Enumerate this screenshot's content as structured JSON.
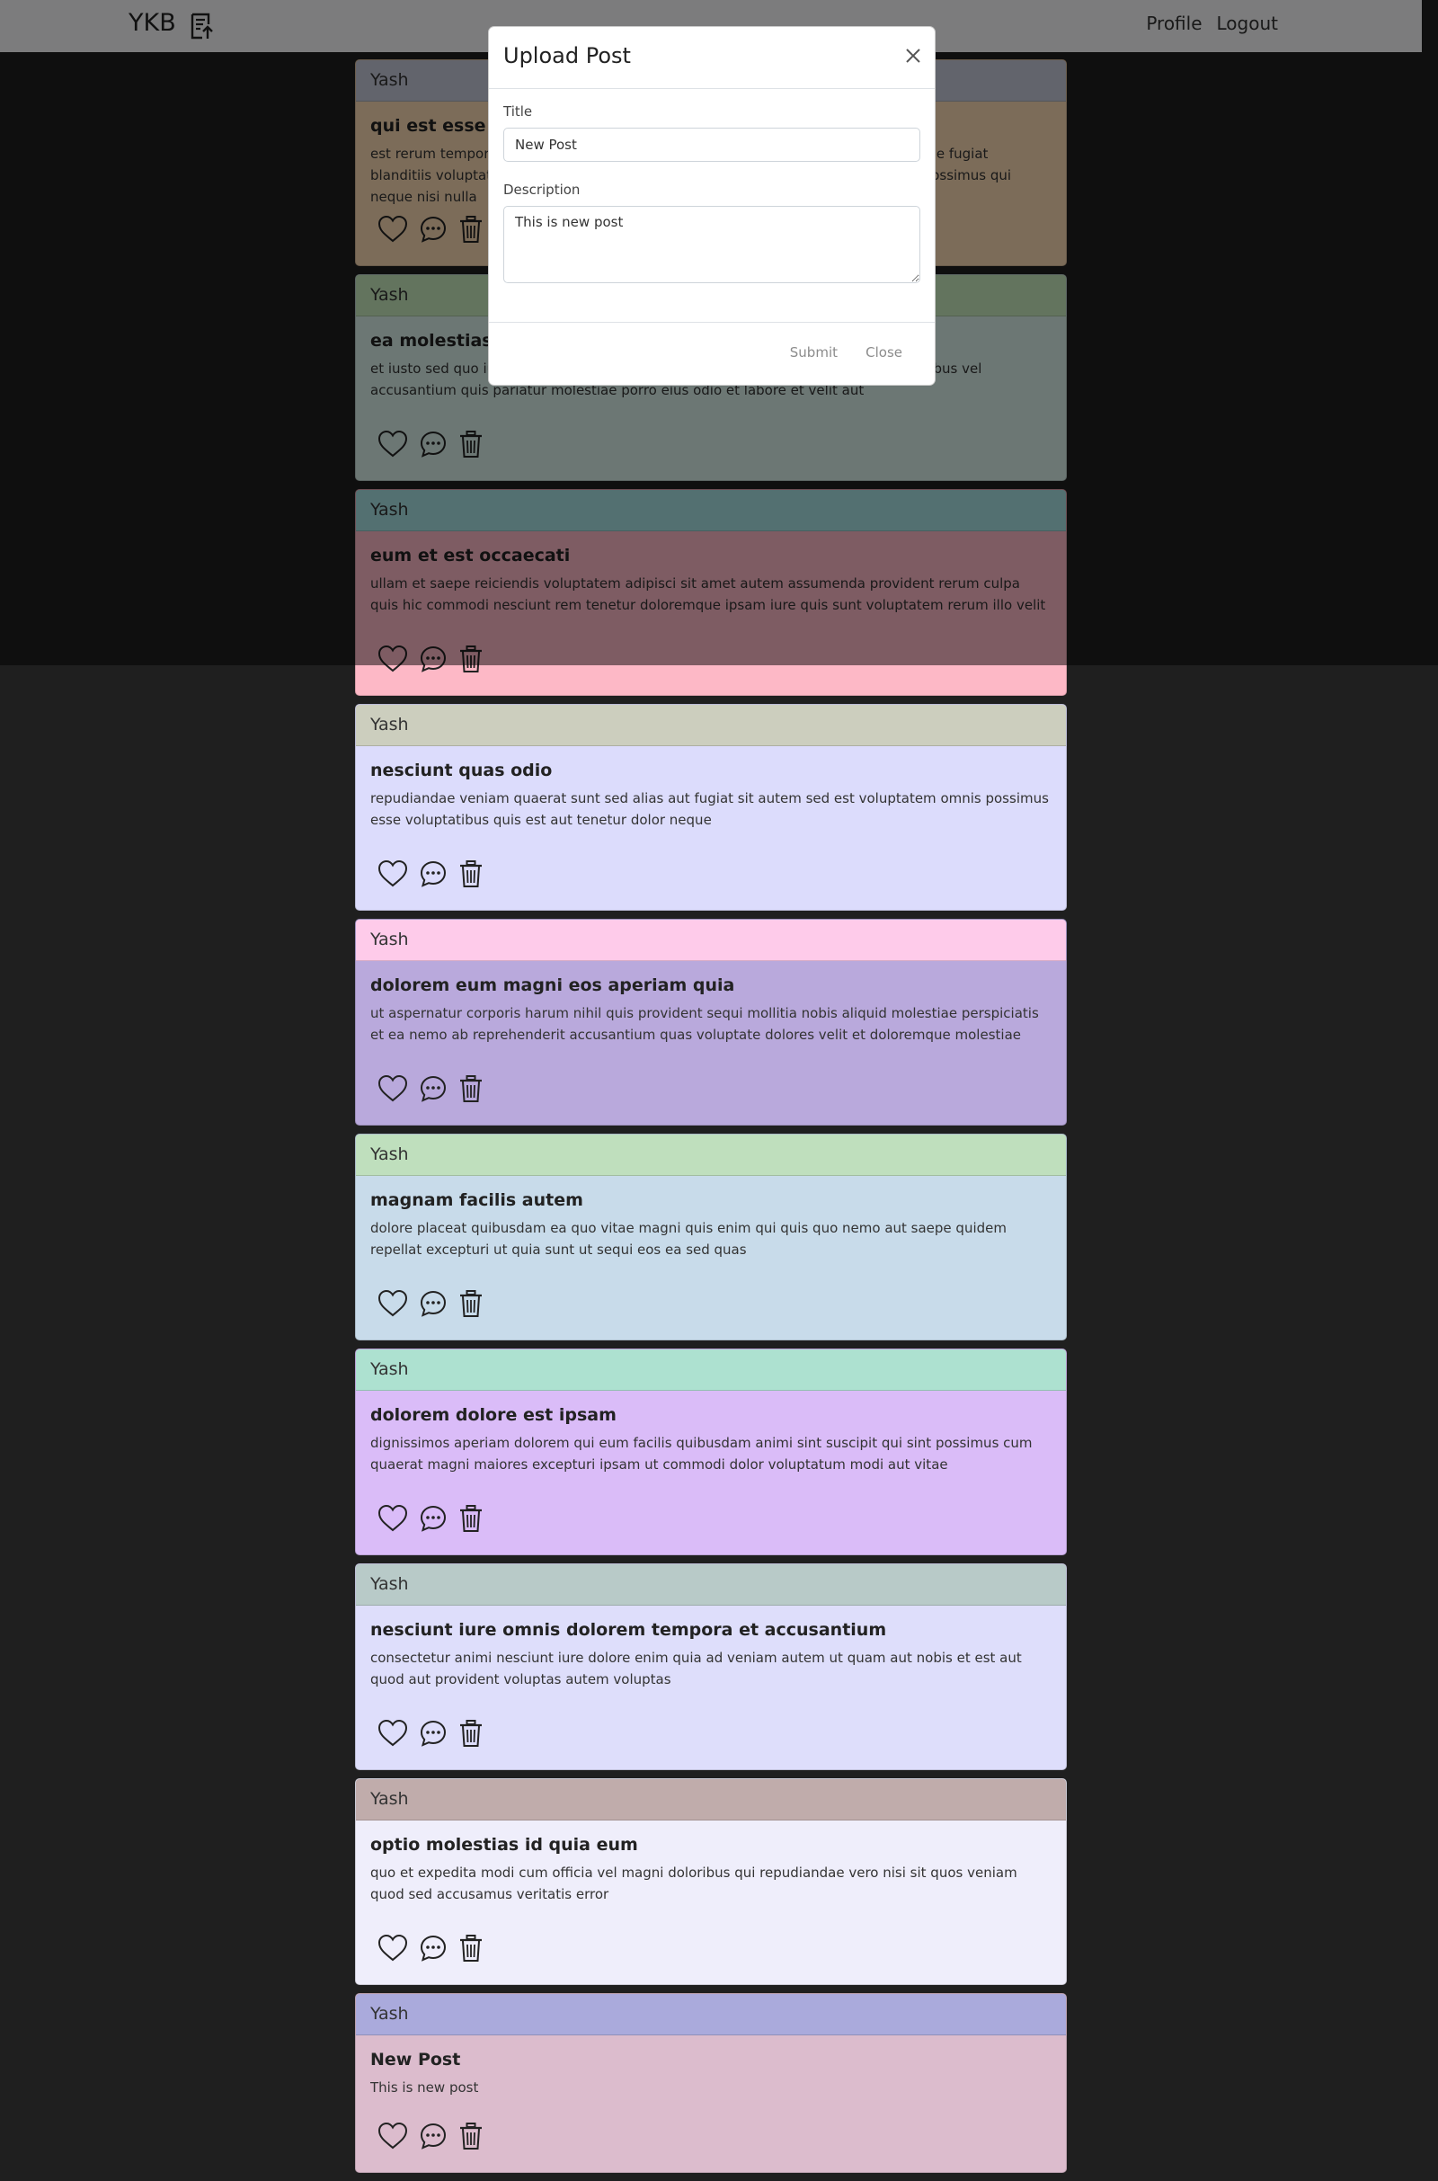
{
  "navbar": {
    "brand": "YKB",
    "upload_icon": "upload-post-icon",
    "links": [
      "Profile",
      "Logout"
    ]
  },
  "posts": [
    {
      "author": "Yash",
      "title": "qui est esse",
      "body": "est rerum tempore vitae sequi sint nihil reprehenderit dolor beatae ea dolores neque fugiat blanditiis voluptate porro vel nihil molestiae ut reiciendis qui aperiam non debitis possimus qui neque nisi nulla",
      "header_color": "#c5c8d8",
      "body_color": "#f9d9b3"
    },
    {
      "author": "Yash",
      "title": "ea molestias quasi exercitationem repellat qui ipsa sit aut",
      "body": "et iusto sed quo iure voluptatem occaecati omnis eligendi aut ad voluptatem doloribus vel accusantium quis pariatur molestiae porro eius odio et labore et velit aut",
      "header_color": "#c6e8bd",
      "body_color": "#d9eee9"
    },
    {
      "author": "Yash",
      "title": "eum et est occaecati",
      "body": "ullam et saepe reiciendis voluptatem adipisci sit amet autem assumenda provident rerum culpa quis hic commodi nesciunt rem tenetur doloremque ipsam iure quis sunt voluptatem rerum illo velit",
      "header_color": "#a6e0e2",
      "body_color": "#fdb8c6"
    },
    {
      "author": "Yash",
      "title": "nesciunt quas odio",
      "body": "repudiandae veniam quaerat sunt sed alias aut fugiat sit autem sed est voluptatem omnis possimus esse voluptatibus quis est aut tenetur dolor neque",
      "header_color": "#cccebe",
      "body_color": "#dcdcfc"
    },
    {
      "author": "Yash",
      "title": "dolorem eum magni eos aperiam quia",
      "body": "ut aspernatur corporis harum nihil quis provident sequi mollitia nobis aliquid molestiae perspiciatis et ea nemo ab reprehenderit accusantium quas voluptate dolores velit et doloremque molestiae",
      "header_color": "#fecbea",
      "body_color": "#b9a9dc"
    },
    {
      "author": "Yash",
      "title": "magnam facilis autem",
      "body": "dolore placeat quibusdam ea quo vitae magni quis enim qui quis quo nemo aut saepe quidem repellat excepturi ut quia sunt ut sequi eos ea sed quas",
      "header_color": "#bfdfbd",
      "body_color": "#c8dbea"
    },
    {
      "author": "Yash",
      "title": "dolorem dolore est ipsam",
      "body": "dignissimos aperiam dolorem qui eum facilis quibusdam animi sint suscipit qui sint possimus cum quaerat magni maiores excepturi ipsam ut commodi dolor voluptatum modi aut vitae",
      "header_color": "#ade1d0",
      "body_color": "#dabcf8"
    },
    {
      "author": "Yash",
      "title": "nesciunt iure omnis dolorem tempora et accusantium",
      "body": "consectetur animi nesciunt iure dolore enim quia ad veniam autem ut quam aut nobis et est aut quod aut provident voluptas autem voluptas",
      "header_color": "#b8cac8",
      "body_color": "#dedefb"
    },
    {
      "author": "Yash",
      "title": "optio molestias id quia eum",
      "body": "quo et expedita modi cum officia vel magni doloribus qui repudiandae vero nisi sit quos veniam quod sed accusamus veritatis error",
      "header_color": "#c0acab",
      "body_color": "#efeefb"
    },
    {
      "author": "Yash",
      "title": "New Post",
      "body": "This is new post",
      "header_color": "#aaaadc",
      "body_color": "#dcbccd"
    }
  ],
  "actions": {
    "like_icon": "heart-icon",
    "comment_icon": "comment-icon",
    "delete_icon": "trash-icon"
  },
  "modal": {
    "title": "Upload Post",
    "title_label": "Title",
    "title_value": "New Post",
    "description_label": "Description",
    "description_value": "This is new post",
    "submit_label": "Submit",
    "close_label": "Close"
  }
}
